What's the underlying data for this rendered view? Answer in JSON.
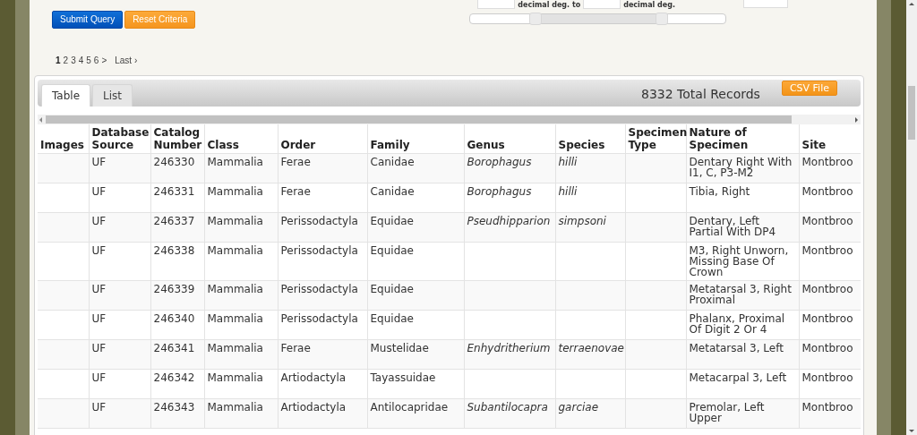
{
  "range_filter": {
    "unit_labels": [
      "decimal deg. to",
      "decimal deg."
    ],
    "handles": [
      {
        "level": 0.255
      },
      {
        "level": 0.75
      }
    ]
  },
  "buttons": [
    {
      "label": "Submit Query",
      "kind": "primary"
    },
    {
      "label": "Reset Criteria",
      "kind": "secondary"
    }
  ],
  "pagination": {
    "pages": [
      {
        "label": "1",
        "selected": true
      },
      {
        "label": "2",
        "selected": false
      },
      {
        "label": "3",
        "selected": false
      },
      {
        "label": "4",
        "selected": false
      },
      {
        "label": "5",
        "selected": false
      },
      {
        "label": "6",
        "selected": false
      }
    ],
    "next": ">",
    "last": "Last ›"
  },
  "tabs": [
    {
      "label": "Table",
      "selected": true
    },
    {
      "label": "List",
      "selected": false
    }
  ],
  "total_records": "8332 Total Records",
  "export_button": "CSV File",
  "table": {
    "columns": [
      {
        "label": "Images",
        "kind": "text"
      },
      {
        "label": "Database Source",
        "kind": "text"
      },
      {
        "label": "Catalog Number",
        "kind": "text"
      },
      {
        "label": "Class",
        "kind": "text"
      },
      {
        "label": "Order",
        "kind": "text"
      },
      {
        "label": "Family",
        "kind": "text"
      },
      {
        "label": "Genus",
        "kind": "taxon"
      },
      {
        "label": "Species",
        "kind": "taxon"
      },
      {
        "label": "Specimen Type",
        "kind": "text"
      },
      {
        "label": "Nature of Specimen",
        "kind": "text"
      },
      {
        "label": "Site",
        "kind": "text"
      }
    ],
    "rows": [
      [
        "",
        "UF",
        "246330",
        "Mammalia",
        "Ferae",
        "Canidae",
        "Borophagus",
        "hilli",
        "",
        "Dentary Right With I1, C, P3-M2",
        "Montbroo"
      ],
      [
        "",
        "UF",
        "246331",
        "Mammalia",
        "Ferae",
        "Canidae",
        "Borophagus",
        "hilli",
        "",
        "Tibia, Right",
        "Montbroo"
      ],
      [
        "",
        "UF",
        "246337",
        "Mammalia",
        "Perissodactyla",
        "Equidae",
        "Pseudhipparion",
        "simpsoni",
        "",
        "Dentary, Left Partial With DP4",
        "Montbroo"
      ],
      [
        "",
        "UF",
        "246338",
        "Mammalia",
        "Perissodactyla",
        "Equidae",
        "",
        "",
        "",
        "M3, Right Unworn, Missing Base Of Crown",
        "Montbroo"
      ],
      [
        "",
        "UF",
        "246339",
        "Mammalia",
        "Perissodactyla",
        "Equidae",
        "",
        "",
        "",
        "Metatarsal 3, Right Proximal",
        "Montbroo"
      ],
      [
        "",
        "UF",
        "246340",
        "Mammalia",
        "Perissodactyla",
        "Equidae",
        "",
        "",
        "",
        "Phalanx, Proximal Of Digit 2 Or 4",
        "Montbroo"
      ],
      [
        "",
        "UF",
        "246341",
        "Mammalia",
        "Ferae",
        "Mustelidae",
        "Enhydritherium",
        "terraenovae",
        "",
        "Metatarsal 3, Left",
        "Montbroo"
      ],
      [
        "",
        "UF",
        "246342",
        "Mammalia",
        "Artiodactyla",
        "Tayassuidae",
        "",
        "",
        "",
        "Metacarpal 3, Left",
        "Montbroo"
      ],
      [
        "",
        "UF",
        "246343",
        "Mammalia",
        "Artiodactyla",
        "Antilocapridae",
        "Subantilocapra",
        "garciae",
        "",
        "Premolar, Left Upper",
        "Montbroo"
      ]
    ]
  }
}
